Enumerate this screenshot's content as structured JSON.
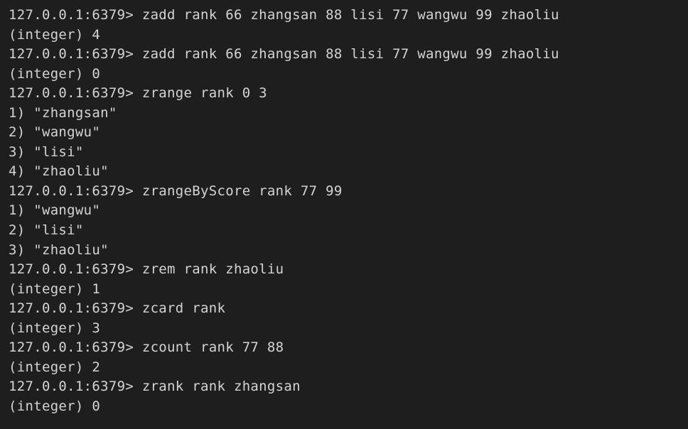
{
  "terminal": {
    "lines": [
      {
        "type": "cmd",
        "prompt": "127.0.0.1:6379> ",
        "command": "zadd rank 66 zhangsan 88 lisi 77 wangwu 99 zhaoliu"
      },
      {
        "type": "out",
        "text": "(integer) 4"
      },
      {
        "type": "cmd",
        "prompt": "127.0.0.1:6379> ",
        "command": "zadd rank 66 zhangsan 88 lisi 77 wangwu 99 zhaoliu"
      },
      {
        "type": "out",
        "text": "(integer) 0"
      },
      {
        "type": "cmd",
        "prompt": "127.0.0.1:6379> ",
        "command": "zrange rank 0 3"
      },
      {
        "type": "out",
        "text": "1) \"zhangsan\""
      },
      {
        "type": "out",
        "text": "2) \"wangwu\""
      },
      {
        "type": "out",
        "text": "3) \"lisi\""
      },
      {
        "type": "out",
        "text": "4) \"zhaoliu\""
      },
      {
        "type": "cmd",
        "prompt": "127.0.0.1:6379> ",
        "command": "zrangeByScore rank 77 99"
      },
      {
        "type": "out",
        "text": "1) \"wangwu\""
      },
      {
        "type": "out",
        "text": "2) \"lisi\""
      },
      {
        "type": "out",
        "text": "3) \"zhaoliu\""
      },
      {
        "type": "cmd",
        "prompt": "127.0.0.1:6379> ",
        "command": "zrem rank zhaoliu"
      },
      {
        "type": "out",
        "text": "(integer) 1"
      },
      {
        "type": "cmd",
        "prompt": "127.0.0.1:6379> ",
        "command": "zcard rank"
      },
      {
        "type": "out",
        "text": "(integer) 3"
      },
      {
        "type": "cmd",
        "prompt": "127.0.0.1:6379> ",
        "command": "zcount rank 77 88"
      },
      {
        "type": "out",
        "text": "(integer) 2"
      },
      {
        "type": "cmd",
        "prompt": "127.0.0.1:6379> ",
        "command": "zrank rank zhangsan"
      },
      {
        "type": "out",
        "text": "(integer) 0"
      }
    ]
  }
}
